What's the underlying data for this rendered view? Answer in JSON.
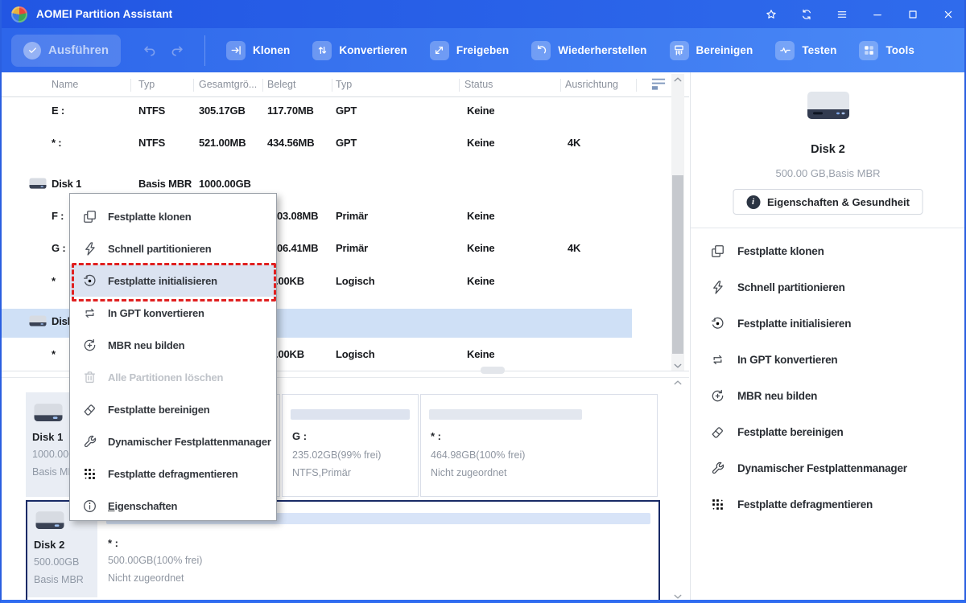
{
  "window": {
    "title": "AOMEI Partition Assistant",
    "controls": [
      {
        "icon": "star-icon"
      },
      {
        "icon": "sync-icon"
      },
      {
        "icon": "hamburger-icon"
      },
      {
        "icon": "minimize-icon"
      },
      {
        "icon": "maximize-icon"
      },
      {
        "icon": "close-icon"
      }
    ]
  },
  "toolbar": {
    "execute_label": "Ausführen",
    "items": [
      {
        "icon": "clone-badge-icon",
        "label": "Klonen"
      },
      {
        "icon": "convert-badge-icon",
        "label": "Konvertieren"
      },
      {
        "icon": "share-badge-icon",
        "label": "Freigeben"
      },
      {
        "icon": "restore-badge-icon",
        "label": "Wiederherstellen"
      },
      {
        "icon": "shred-badge-icon",
        "label": "Bereinigen"
      },
      {
        "icon": "test-badge-icon",
        "label": "Testen"
      },
      {
        "icon": "tools-badge-icon",
        "label": "Tools"
      }
    ]
  },
  "table": {
    "columns": [
      "Name",
      "Typ",
      "Gesamtgrö...",
      "Belegt",
      "Typ",
      "Status",
      "Ausrichtung"
    ],
    "rows": [
      {
        "name": "E :",
        "fs": "NTFS",
        "size": "305.17GB",
        "used": "117.70MB",
        "ptype": "GPT",
        "status": "Keine",
        "align": ""
      },
      {
        "name": "* :",
        "fs": "NTFS",
        "size": "521.00MB",
        "used": "434.56MB",
        "ptype": "GPT",
        "status": "Keine",
        "align": "4K"
      },
      {
        "name": "Disk 1",
        "disk": true,
        "fs": "Basis MBR",
        "size": "1000.00GB"
      },
      {
        "name": "F :",
        "used": "03.08MB",
        "ptype": "Primär",
        "status": "Keine",
        "align": ""
      },
      {
        "name": "G :",
        "used": "06.41MB",
        "ptype": "Primär",
        "status": "Keine",
        "align": "4K"
      },
      {
        "name": "*",
        "used": "1.00KB",
        "ptype": "Logisch",
        "status": "Keine",
        "align": ""
      },
      {
        "name": "Disk 2",
        "disk": true,
        "selected": true
      },
      {
        "name": "*",
        "used": "1.00KB",
        "ptype": "Logisch",
        "status": "Keine",
        "align": ""
      }
    ]
  },
  "context_menu": {
    "items": [
      {
        "icon": "clone-icon",
        "label": "Festplatte klonen"
      },
      {
        "icon": "flash-icon",
        "label": "Schnell partitionieren"
      },
      {
        "icon": "initialize-icon",
        "label": "Festplatte initialisieren",
        "highlighted": true
      },
      {
        "icon": "convert-gpt-icon",
        "label": "In GPT konvertieren"
      },
      {
        "icon": "rebuild-mbr-icon",
        "label": "MBR neu bilden"
      },
      {
        "icon": "trash-icon",
        "label": "Alle Partitionen löschen",
        "disabled": true
      },
      {
        "icon": "wipe-icon",
        "label": "Festplatte bereinigen"
      },
      {
        "icon": "wrench-icon",
        "label": "Dynamischer Festplattenmanager"
      },
      {
        "icon": "defrag-icon",
        "label": "Festplatte defragmentieren"
      },
      {
        "icon": "info-icon",
        "label": "Eigenschaften",
        "underline_first": true
      }
    ]
  },
  "sidebar": {
    "disk_name": "Disk 2",
    "disk_info": "500.00 GB,Basis MBR",
    "properties_button": "Eigenschaften & Gesundheit",
    "actions": [
      {
        "icon": "clone-icon",
        "label": "Festplatte klonen"
      },
      {
        "icon": "flash-icon",
        "label": "Schnell partitionieren"
      },
      {
        "icon": "initialize-icon",
        "label": "Festplatte initialisieren"
      },
      {
        "icon": "convert-gpt-icon",
        "label": "In GPT konvertieren"
      },
      {
        "icon": "rebuild-mbr-icon",
        "label": "MBR neu bilden"
      },
      {
        "icon": "wipe-icon",
        "label": "Festplatte bereinigen"
      },
      {
        "icon": "wrench-icon",
        "label": "Dynamischer Festplattenmanager"
      },
      {
        "icon": "defrag-icon",
        "label": "Festplatte defragmentieren"
      }
    ]
  },
  "bottom_disks": [
    {
      "name": "Disk 1",
      "size": "1000.00GB",
      "type": "Basis MBR",
      "selected": false,
      "partitions": [
        {
          "label": "",
          "size": "",
          "fs": ""
        },
        {
          "label": "G :",
          "size": "235.02GB(99% frei)",
          "fs": "NTFS,Primär"
        },
        {
          "label": "* :",
          "size": "464.98GB(100% frei)",
          "fs": "Nicht zugeordnet"
        }
      ]
    },
    {
      "name": "Disk 2",
      "size": "500.00GB",
      "type": "Basis MBR",
      "selected": true,
      "partitions": [
        {
          "label": "* :",
          "size": "500.00GB(100% frei)",
          "fs": "Nicht zugeordnet"
        }
      ]
    }
  ],
  "colors": {
    "titlebar": "#2a63e8",
    "accent": "#3b7cf2",
    "highlight_row": "#cfe0f6",
    "menu_highlight": "#dbe3f1",
    "red_dashed": "#e02020",
    "selected_border": "#182a66"
  }
}
